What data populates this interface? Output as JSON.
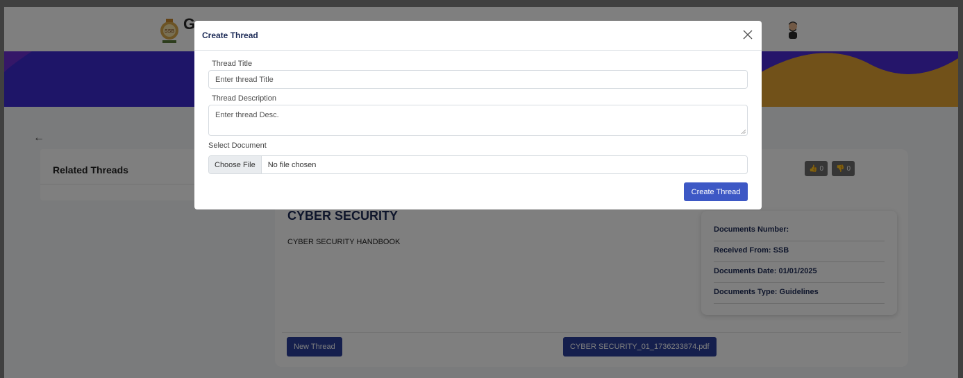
{
  "header": {
    "brand_letter": "G"
  },
  "page": {
    "related_threads_title": "Related Threads",
    "votes": {
      "up_count": "0",
      "down_count": "0"
    },
    "document": {
      "title": "CYBER SECURITY",
      "subtitle": "CYBER SECURITY HANDBOOK"
    },
    "info": {
      "number": "Documents Number:",
      "received_from": "Received From: SSB",
      "date": "Documents Date: 01/01/2025",
      "type": "Documents Type: Guidelines"
    },
    "new_thread_label": "New Thread",
    "pdf_label": "CYBER SECURITY_01_1736233874.pdf"
  },
  "modal": {
    "title": "Create Thread",
    "thread_title_label": "Thread Title",
    "thread_title_placeholder": "Enter thread Title",
    "thread_desc_label": "Thread Description",
    "thread_desc_placeholder": "Enter thread Desc.",
    "select_doc_label": "Select Document",
    "choose_file_label": "Choose File",
    "file_status": "No file chosen",
    "submit_label": "Create Thread"
  },
  "colors": {
    "banner": "#3d2ad0",
    "banner_accent": "#e3a233",
    "primary_button": "#3d58c5",
    "dark_button": "#2a3e9a"
  }
}
